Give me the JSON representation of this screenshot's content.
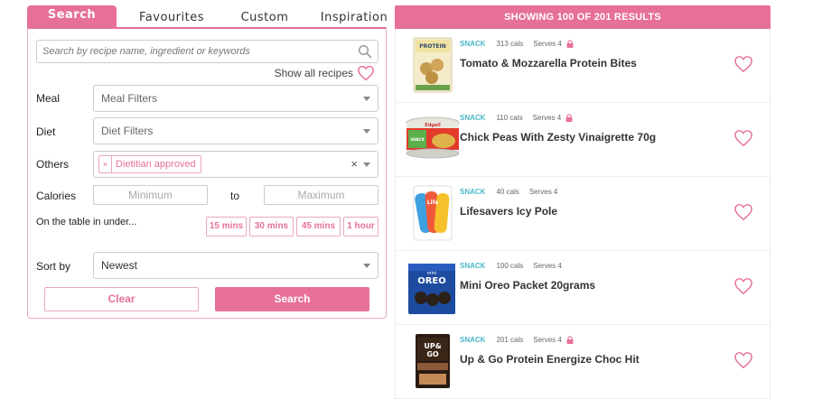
{
  "tabs": {
    "search": "Search",
    "favourites": "Favourites",
    "custom": "Custom",
    "inspiration": "Inspiration"
  },
  "search": {
    "placeholder": "Search by recipe name, ingredient or keywords",
    "show_all": "Show all recipes"
  },
  "filters": {
    "meal_label": "Meal",
    "meal_value": "Meal Filters",
    "diet_label": "Diet",
    "diet_value": "Diet Filters",
    "others_label": "Others",
    "others_chip": "Dietitian approved",
    "others_chip_remove": "×",
    "others_clear": "×",
    "calories_label": "Calories",
    "calories_min": "Minimum",
    "calories_to": "to",
    "calories_max": "Maximum",
    "time_label": "On the table in under...",
    "time_options": [
      "15 mins",
      "30 mins",
      "45 mins",
      "1 hour"
    ],
    "sort_label": "Sort by",
    "sort_value": "Newest",
    "clear_label": "Clear",
    "search_label": "Search"
  },
  "results": {
    "header": "SHOWING 100 OF 201 RESULTS",
    "items": [
      {
        "type": "SNACK",
        "cals": "313 cals",
        "serves": "Serves 4",
        "locked": true,
        "title": "Tomato & Mozzarella Protein Bites",
        "thumb_label": "PROTEIN BITES"
      },
      {
        "type": "SNACK",
        "cals": "110 cals",
        "serves": "Serves 4",
        "locked": true,
        "title": "Chick Peas With Zesty Vinaigrette 70g",
        "thumb_label": "Edgell SNACK TIME"
      },
      {
        "type": "SNACK",
        "cals": "40 cals",
        "serves": "Serves 4",
        "locked": false,
        "title": "Lifesavers Icy Pole",
        "thumb_label": "Life Savers"
      },
      {
        "type": "SNACK",
        "cals": "100 cals",
        "serves": "Serves 4",
        "locked": false,
        "title": "Mini Oreo Packet 20grams",
        "thumb_label": "mini OREO"
      },
      {
        "type": "SNACK",
        "cals": "201 cals",
        "serves": "Serves 4",
        "locked": true,
        "title": "Up & Go Protein Energize Choc Hit",
        "thumb_label": "UP&GO PROTEIN"
      }
    ]
  },
  "colors": {
    "accent": "#e6709a",
    "accent_light": "#e8a8c0",
    "type_label": "#4ab8c8"
  }
}
